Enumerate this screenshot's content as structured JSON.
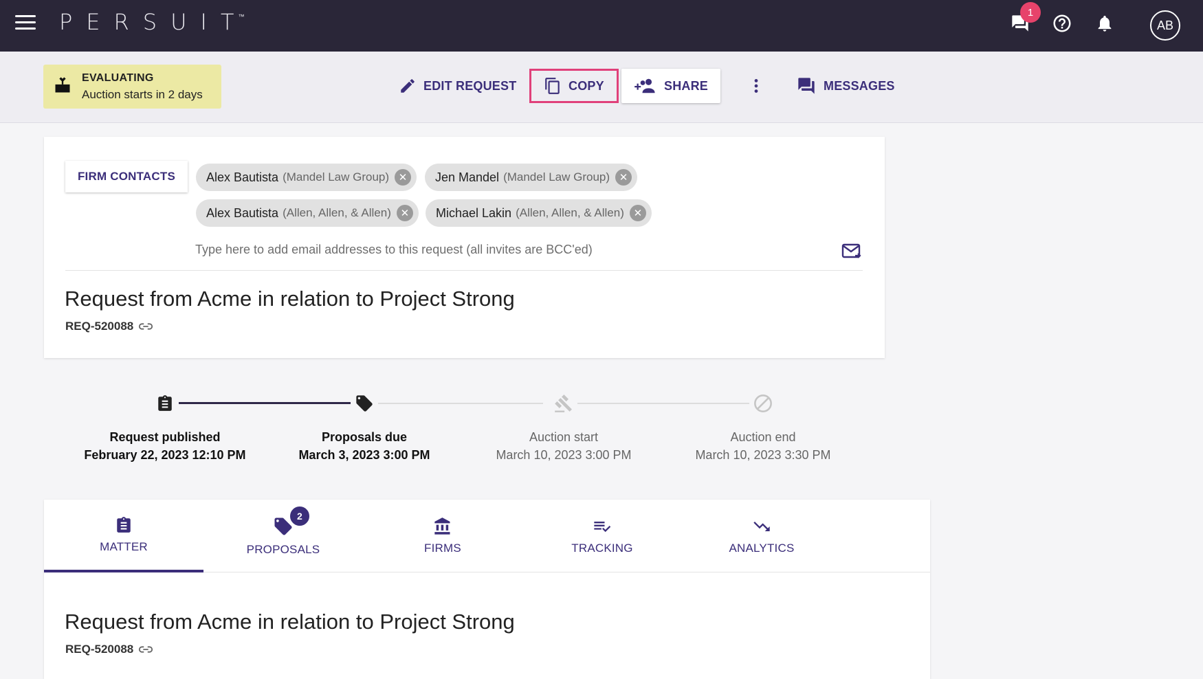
{
  "header": {
    "logo": "PERSUIT",
    "logo_tm": "™",
    "chat_badge": "1",
    "avatar_initials": "AB"
  },
  "status": {
    "label": "EVALUATING",
    "detail": "Auction starts in 2 days",
    "color": "#ece9a4"
  },
  "toolbar": {
    "edit_label": "EDIT REQUEST",
    "copy_label": "COPY",
    "share_label": "SHARE",
    "messages_label": "MESSAGES"
  },
  "invite": {
    "firm_contacts_label": "FIRM CONTACTS",
    "contacts": [
      {
        "name": "Alex Bautista",
        "org": "(Mandel Law Group)"
      },
      {
        "name": "Jen Mandel",
        "org": "(Mandel Law Group)"
      },
      {
        "name": "Alex Bautista",
        "org": "(Allen, Allen, & Allen)"
      },
      {
        "name": "Michael Lakin",
        "org": "(Allen, Allen, & Allen)"
      }
    ],
    "email_placeholder": "Type here to add email addresses to this request (all invites are BCC'ed)"
  },
  "request": {
    "title": "Request from Acme in relation to Project Strong",
    "id": "REQ-520088"
  },
  "timeline": [
    {
      "label": "Request published",
      "date": "February 22, 2023 12:10 PM",
      "state": "done",
      "icon": "clipboard-icon"
    },
    {
      "label": "Proposals due",
      "date": "March 3, 2023 3:00 PM",
      "state": "done",
      "icon": "tag-icon"
    },
    {
      "label": "Auction start",
      "date": "March 10, 2023 3:00 PM",
      "state": "future",
      "icon": "gavel-icon"
    },
    {
      "label": "Auction end",
      "date": "March 10, 2023 3:30 PM",
      "state": "future",
      "icon": "prohibited-icon"
    }
  ],
  "tabs": [
    {
      "label": "MATTER",
      "icon": "clipboard-icon",
      "active": true
    },
    {
      "label": "PROPOSALS",
      "icon": "tag-icon",
      "badge": "2"
    },
    {
      "label": "FIRMS",
      "icon": "bank-icon"
    },
    {
      "label": "TRACKING",
      "icon": "checklist-icon"
    },
    {
      "label": "ANALYTICS",
      "icon": "trending-down-icon"
    }
  ],
  "colors": {
    "topbar": "#2a2638",
    "accent": "#3b2e7a",
    "copy_highlight": "#e0407a",
    "badge_red": "#e7436b"
  }
}
